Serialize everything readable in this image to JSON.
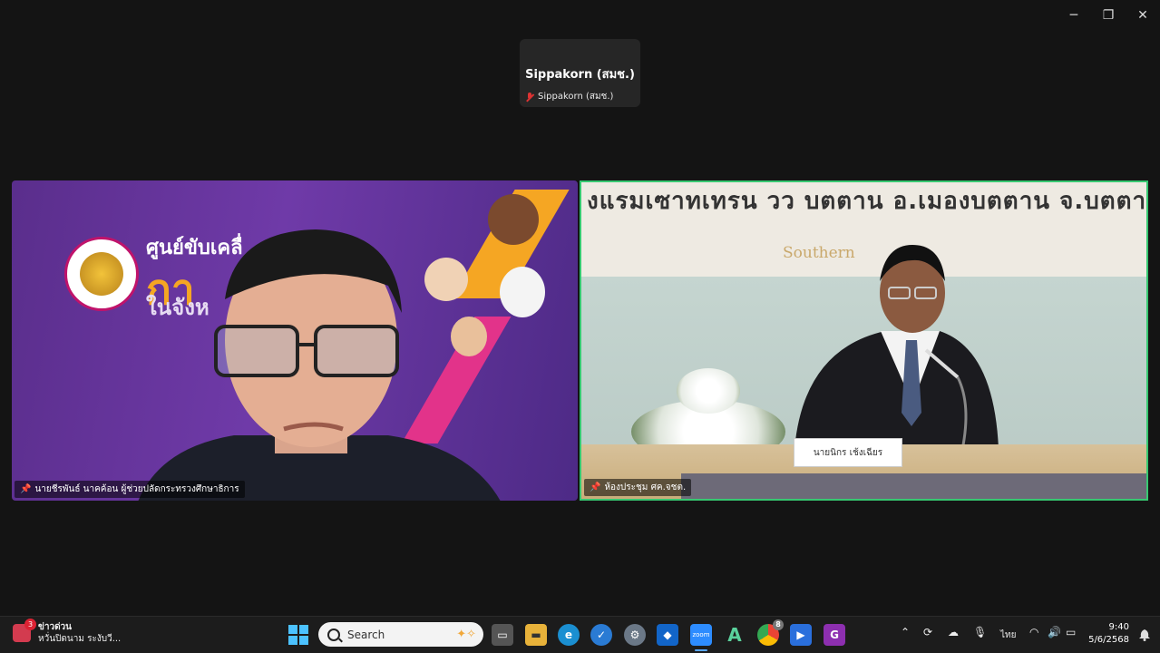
{
  "window": {
    "minimize_glyph": "─",
    "restore_glyph": "❐",
    "close_glyph": "✕"
  },
  "top_participant": {
    "display_name": "Sippakorn (สมช.)",
    "label": "Sippakorn (สมช.)"
  },
  "video_left": {
    "name_label": "นายชีรพันธ์ นาคค้อน ผู้ช่วยปลัดกระทรวงศึกษาธิการ",
    "banner_line1": "ศูนย์ขับเคลื่",
    "banner_line2": "กา",
    "banner_line3": "ในจังห"
  },
  "video_right": {
    "name_label": "ห้องประชุม ศค.จชต.",
    "sign_text": "งแรมเซาทเทรน วว บตตาน อ.เมองบตตาน จ.บตตา",
    "logo_text": "Southern",
    "nameplate": "นายนิกร เช้งเฉียร"
  },
  "taskbar": {
    "news_title": "ข่าวด่วน",
    "news_sub": "หวั่นปิดนาม ระงับวี...",
    "news_badge": "3",
    "search_placeholder": "Search",
    "zoom_label": "zoom",
    "chrome_badge": "8",
    "language": "ไทย",
    "time": "9:40",
    "date": "5/6/2568"
  }
}
